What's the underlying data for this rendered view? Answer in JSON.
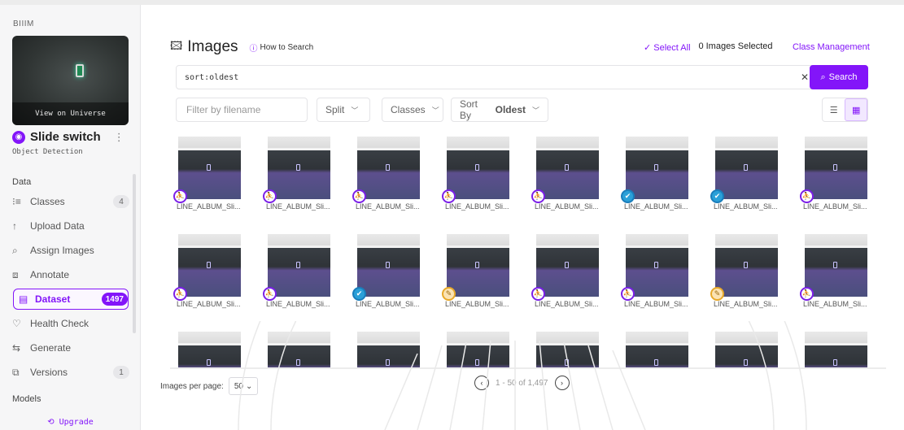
{
  "sidebar": {
    "workspace": "BIIIM",
    "thumbnail_caption": "View on Universe",
    "project_name": "Slide switch",
    "project_type": "Object Detection",
    "section_data": "Data",
    "section_models": "Models",
    "items": [
      {
        "icon": "list-icon",
        "label": "Classes",
        "count": "4"
      },
      {
        "icon": "upload-icon",
        "label": "Upload Data",
        "count": ""
      },
      {
        "icon": "search-icon",
        "label": "Assign Images",
        "count": ""
      },
      {
        "icon": "annotate-icon",
        "label": "Annotate",
        "count": ""
      },
      {
        "icon": "dataset-icon",
        "label": "Dataset",
        "count": "1497",
        "active": true
      },
      {
        "icon": "health-icon",
        "label": "Health Check",
        "count": ""
      },
      {
        "icon": "generate-icon",
        "label": "Generate",
        "count": ""
      },
      {
        "icon": "versions-icon",
        "label": "Versions",
        "count": "1"
      }
    ],
    "upgrade": "Upgrade"
  },
  "header": {
    "title": "Images",
    "how_to_search": "How to Search",
    "select_all": "Select All",
    "images_selected": "0 Images Selected",
    "class_management": "Class Management"
  },
  "search": {
    "query": "sort:oldest",
    "button": "Search"
  },
  "filters": {
    "filename_placeholder": "Filter by filename",
    "split": "Split",
    "classes": "Classes",
    "sort_by": "Sort By",
    "sort_value": "Oldest"
  },
  "grid": {
    "rows": [
      {
        "tiles": [
          {
            "label": "LINE_ALBUM_Sli...",
            "status": "unannotated"
          },
          {
            "label": "LINE_ALBUM_Sli...",
            "status": "unannotated"
          },
          {
            "label": "LINE_ALBUM_Sli...",
            "status": "unannotated"
          },
          {
            "label": "LINE_ALBUM_Sli...",
            "status": "unannotated"
          },
          {
            "label": "LINE_ALBUM_Sli...",
            "status": "unannotated"
          },
          {
            "label": "LINE_ALBUM_Sli...",
            "status": "annotated"
          },
          {
            "label": "LINE_ALBUM_Sli...",
            "status": "annotated"
          },
          {
            "label": "LINE_ALBUM_Sli...",
            "status": "unannotated"
          }
        ]
      },
      {
        "tiles": [
          {
            "label": "LINE_ALBUM_Sli...",
            "status": "unannotated"
          },
          {
            "label": "LINE_ALBUM_Sli...",
            "status": "unannotated"
          },
          {
            "label": "LINE_ALBUM_Sli...",
            "status": "annotated"
          },
          {
            "label": "LINE_ALBUM_Sli...",
            "status": "edited"
          },
          {
            "label": "LINE_ALBUM_Sli...",
            "status": "unannotated"
          },
          {
            "label": "LINE_ALBUM_Sli...",
            "status": "unannotated"
          },
          {
            "label": "LINE_ALBUM_Sli...",
            "status": "edited"
          },
          {
            "label": "LINE_ALBUM_Sli...",
            "status": "unannotated"
          }
        ]
      },
      {
        "tiles": [
          {
            "label": "",
            "status": "none"
          },
          {
            "label": "",
            "status": "none"
          },
          {
            "label": "",
            "status": "none"
          },
          {
            "label": "",
            "status": "none"
          },
          {
            "label": "",
            "status": "none"
          },
          {
            "label": "",
            "status": "none"
          },
          {
            "label": "",
            "status": "none"
          },
          {
            "label": "",
            "status": "none"
          }
        ]
      }
    ]
  },
  "pagination": {
    "per_page_label": "Images per page:",
    "per_page_value": "50",
    "range": "1 - 50 of 1,497"
  },
  "colors": {
    "accent": "#8315f9"
  }
}
